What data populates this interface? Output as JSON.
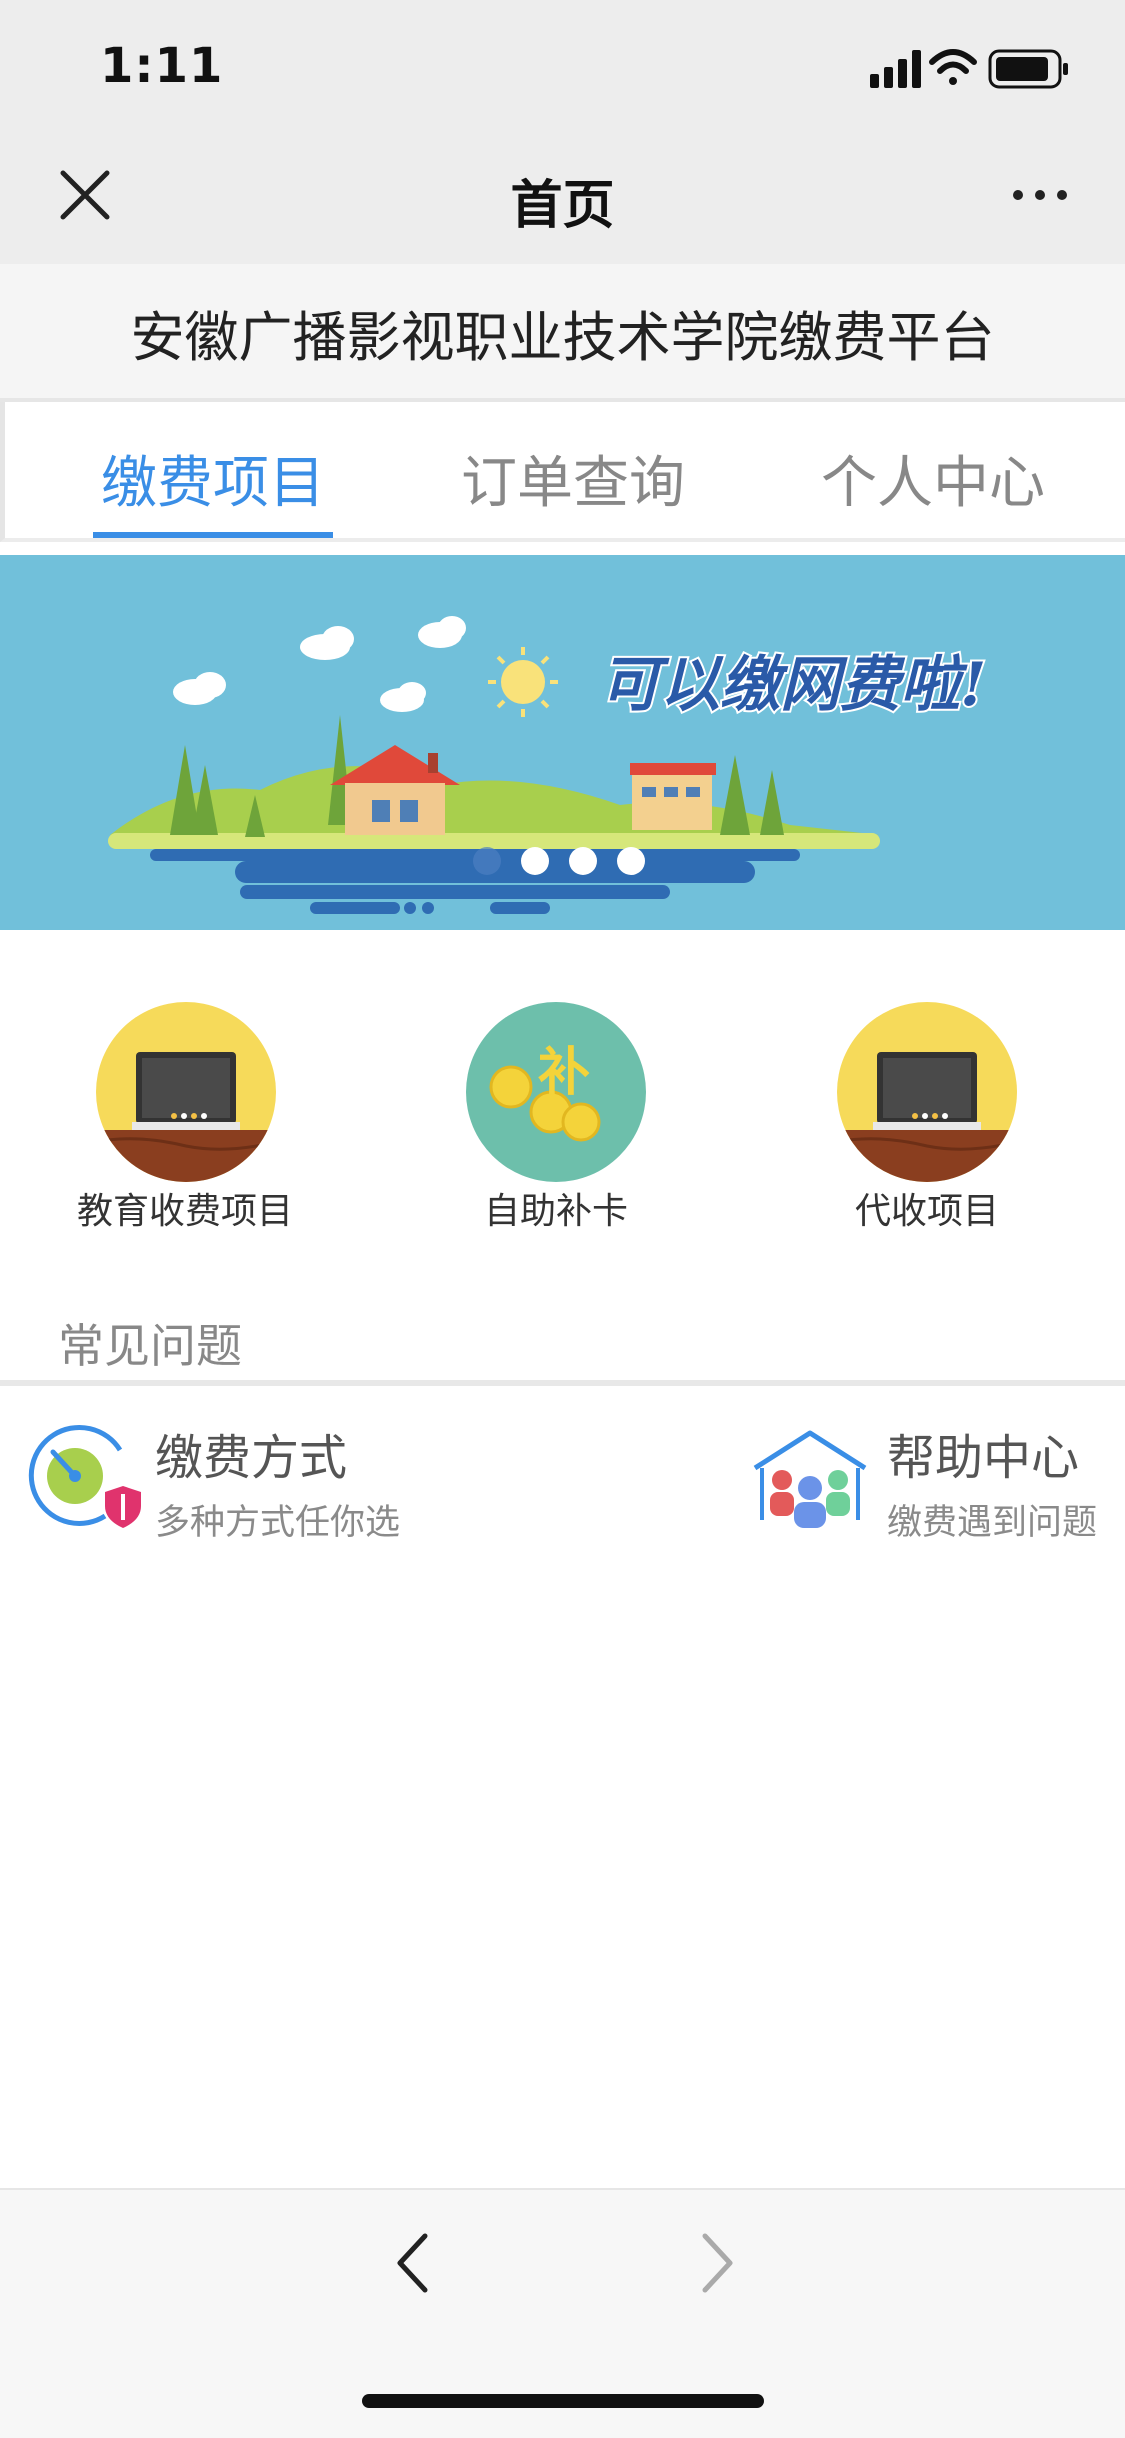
{
  "status": {
    "time": "1:11"
  },
  "nav": {
    "title": "首页",
    "close_icon": "close-icon",
    "more_icon": "more-icon"
  },
  "header": {
    "title": "安徽广播影视职业技术学院缴费平台"
  },
  "tabs": [
    {
      "label": "缴费项目",
      "active": true
    },
    {
      "label": "订单查询",
      "active": false
    },
    {
      "label": "个人中心",
      "active": false
    }
  ],
  "banner": {
    "slogan": "可以缴网费啦!",
    "slide_count": 4,
    "active_slide": 1
  },
  "services": [
    {
      "label": "教育收费项目",
      "icon": "blackboard-icon"
    },
    {
      "label": "自助补卡",
      "icon": "coins-icon",
      "glyph": "补"
    },
    {
      "label": "代收项目",
      "icon": "blackboard-icon"
    }
  ],
  "faq": {
    "title": "常见问题",
    "items": [
      {
        "title": "缴费方式",
        "subtitle": "多种方式任你选",
        "icon": "payment-shield-icon"
      },
      {
        "title": "帮助中心",
        "subtitle": "缴费遇到问题",
        "icon": "help-house-icon"
      }
    ]
  },
  "colors": {
    "accent": "#3a8ee6",
    "banner_bg": "#71c0da",
    "coin_bg": "#6dbfab",
    "yellow_bg": "#f6da5a"
  }
}
